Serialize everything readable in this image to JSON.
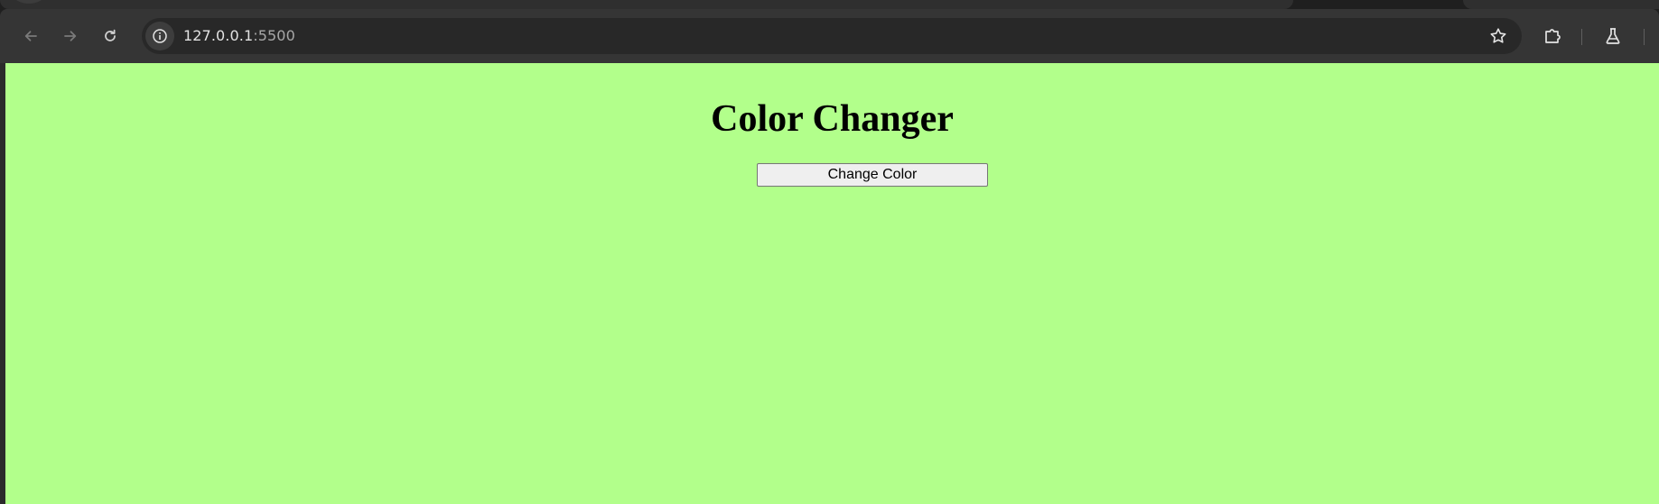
{
  "browser": {
    "address_bar": {
      "host": "127.0.0.1",
      "port": ":5500"
    },
    "icons": {
      "back": "back-arrow-icon",
      "forward": "forward-arrow-icon",
      "reload": "reload-icon",
      "site_info": "info-icon",
      "bookmark": "star-icon",
      "extensions": "puzzle-icon",
      "labs": "flask-icon"
    },
    "colors": {
      "toolbar": "#353535",
      "omnibox": "#282828"
    }
  },
  "page": {
    "title": "Color Changer",
    "button_label": "Change Color",
    "background_color": "#b2ff8b"
  }
}
